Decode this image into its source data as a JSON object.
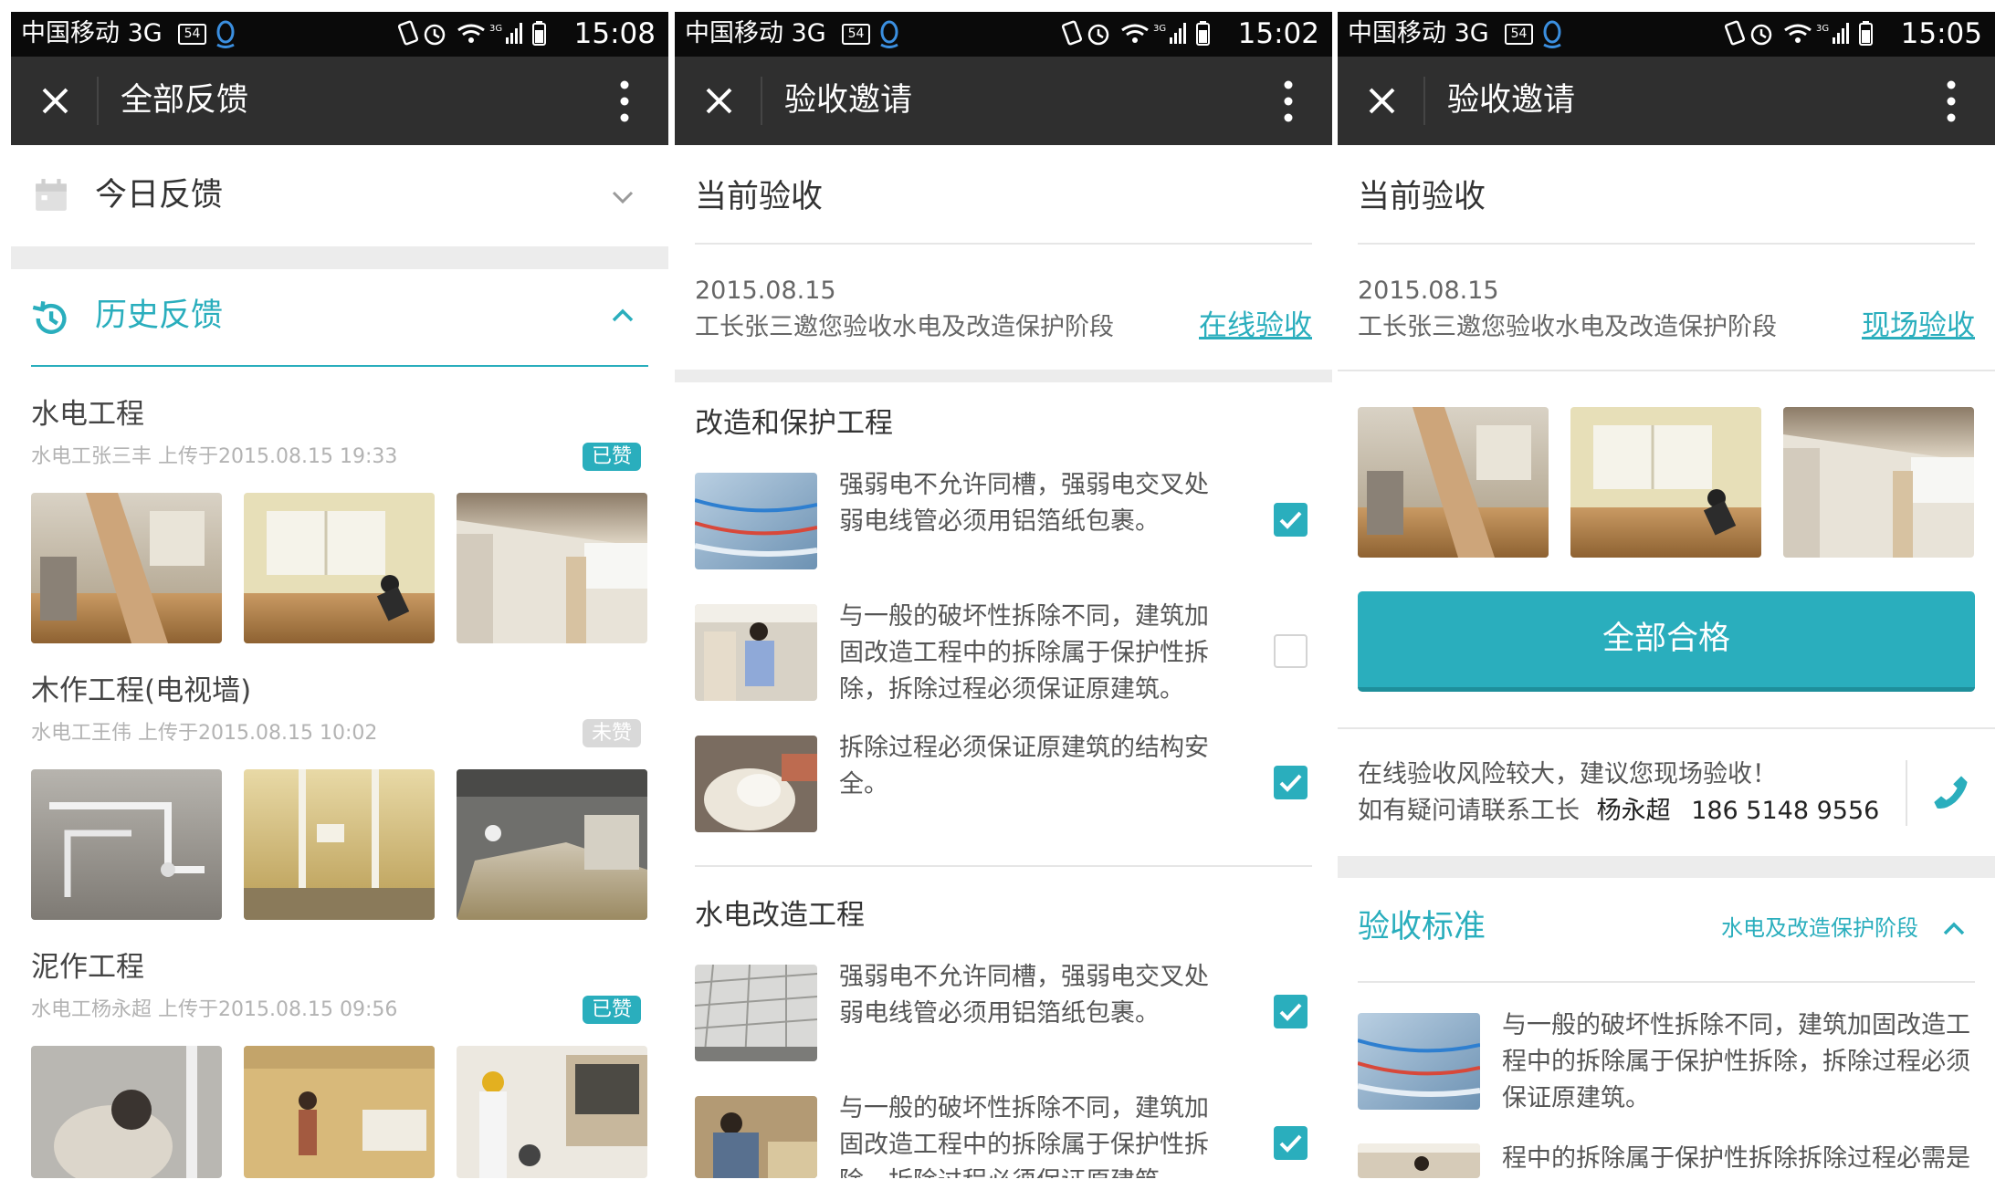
{
  "status_bars": [
    {
      "carrier": "中国移动 3G",
      "badge": "54",
      "time": "15:08"
    },
    {
      "carrier": "中国移动 3G",
      "badge": "54",
      "time": "15:02"
    },
    {
      "carrier": "中国移动 3G",
      "badge": "54",
      "time": "15:05"
    }
  ],
  "screen1": {
    "title": "全部反馈",
    "today_label": "今日反馈",
    "history_label": "历史反馈",
    "groups": [
      {
        "name": "水电工程",
        "meta": "水电工张三丰  上传于2015.08.15 19:33",
        "badge": "已赞"
      },
      {
        "name": "木作工程(电视墙)",
        "meta": "水电工王伟  上传于2015.08.15 10:02",
        "badge": "未赞"
      },
      {
        "name": "泥作工程",
        "meta": "水电工杨永超  上传于2015.08.15 09:56",
        "badge": "已赞"
      }
    ]
  },
  "screen2": {
    "title": "验收邀请",
    "current_label": "当前验收",
    "date": "2015.08.15",
    "invite_text": "工长张三邀您验收水电及改造保护阶段",
    "action_link": "在线验收",
    "sections": [
      {
        "title": "改造和保护工程",
        "items": [
          {
            "line1": "强弱电不允许同槽，强弱电交叉处",
            "line2": "弱电线管必须用铝箔纸包裹。",
            "line3": "",
            "checked": true
          },
          {
            "line1": "与一般的破坏性拆除不同，建筑加",
            "line2": "固改造工程中的拆除属于保护性拆",
            "line3": "除，拆除过程必须保证原建筑。",
            "checked": false
          },
          {
            "line1": "拆除过程必须保证原建筑的结构安",
            "line2": "全。",
            "line3": "",
            "checked": true
          }
        ]
      },
      {
        "title": "水电改造工程",
        "items": [
          {
            "line1": "强弱电不允许同槽，强弱电交叉处",
            "line2": "弱电线管必须用铝箔纸包裹。",
            "line3": "",
            "checked": true
          },
          {
            "line1": "与一般的破坏性拆除不同，建筑加",
            "line2": "固改造工程中的拆除属于保护性拆",
            "line3": "除，拆除过程必须保证原建筑。",
            "checked": true
          }
        ]
      }
    ]
  },
  "screen3": {
    "title": "验收邀请",
    "current_label": "当前验收",
    "date": "2015.08.15",
    "invite_text": "工长张三邀您验收水电及改造保护阶段",
    "action_link": "现场验收",
    "pass_button": "全部合格",
    "risk_text": "在线验收风险较大，建议您现场验收！",
    "contact_prefix": "如有疑问请联系工长",
    "contact_name": "杨永超",
    "contact_phone": "186 5148 9556",
    "standard_label": "验收标准",
    "standard_stage": "水电及改造保护阶段",
    "standards": [
      {
        "line1": "与一般的破坏性拆除不同，建筑加固改造工",
        "line2": "程中的拆除属于保护性拆除，拆除过程必须",
        "line3": "保证原建筑。"
      },
      {
        "line1": "程中的拆除属于保护性拆除拆除过程必需是",
        "line2": "",
        "line3": ""
      }
    ]
  },
  "colors": {
    "accent": "#2aaebd",
    "status_bar": "#0a0a0a",
    "app_bar": "#2f2f2f",
    "badge_on": "#2aaebd",
    "badge_off": "#d9d9d9"
  },
  "icons": [
    "close-icon",
    "more-vert-icon",
    "calendar-icon",
    "history-icon",
    "chevron-down-icon",
    "chevron-up-icon",
    "checkbox-checked-icon",
    "checkbox-empty-icon",
    "phone-icon",
    "wifi-icon",
    "signal-icon",
    "battery-icon",
    "alarm-icon",
    "vibrate-icon",
    "qq-penguin-icon"
  ]
}
